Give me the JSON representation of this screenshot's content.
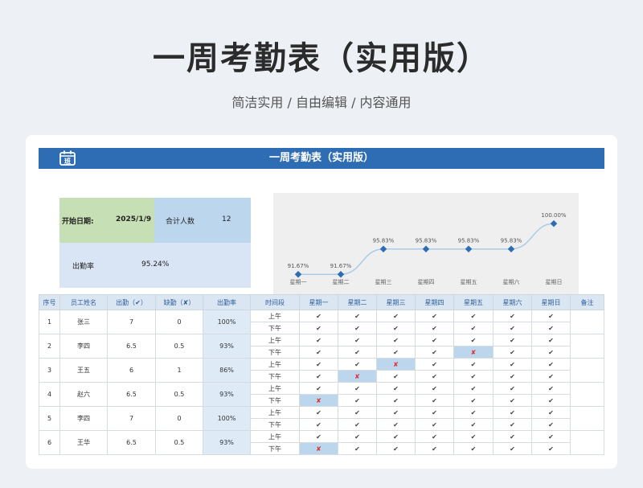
{
  "page": {
    "title": "一周考勤表（实用版）",
    "subtitle": "简洁实用 / 自由编辑 / 内容通用"
  },
  "sheet": {
    "banner_title": "一周考勤表（实用版）",
    "calendar_icon_text": "班",
    "summary": {
      "start_label": "开始日期:",
      "start_value": "2025/1/9",
      "count_label": "合计人数",
      "count_value": "12",
      "rate_label": "出勤率",
      "rate_value": "95.24%"
    }
  },
  "chart_data": {
    "type": "line",
    "categories": [
      "星期一",
      "星期二",
      "星期三",
      "星期四",
      "星期五",
      "星期六",
      "星期日"
    ],
    "values": [
      91.67,
      91.67,
      95.83,
      95.83,
      95.83,
      95.83,
      100.0
    ],
    "value_labels": [
      "91.67%",
      "91.67%",
      "95.83%",
      "95.83%",
      "95.83%",
      "95.83%",
      "100.00%"
    ],
    "ylim": [
      88,
      102
    ],
    "grid": false,
    "colors": {
      "line": "#a9cbe8",
      "marker": "#2e6db4"
    }
  },
  "table": {
    "headers": [
      "序号",
      "员工姓名",
      "出勤（✔）",
      "缺勤（✘）",
      "出勤率",
      "时间段",
      "星期一",
      "星期二",
      "星期三",
      "星期四",
      "星期五",
      "星期六",
      "星期日",
      "备注"
    ],
    "present_mark": "✔",
    "absent_mark": "✘",
    "rows": [
      {
        "no": "1",
        "name": "张三",
        "present": "7",
        "absent": "0",
        "rate": "100%",
        "am": "上午",
        "pm": "下午",
        "am_marks": [
          "✔",
          "✔",
          "✔",
          "✔",
          "✔",
          "✔",
          "✔"
        ],
        "pm_marks": [
          "✔",
          "✔",
          "✔",
          "✔",
          "✔",
          "✔",
          "✔"
        ]
      },
      {
        "no": "2",
        "name": "李四",
        "present": "6.5",
        "absent": "0.5",
        "rate": "93%",
        "am": "上午",
        "pm": "下午",
        "am_marks": [
          "✔",
          "✔",
          "✔",
          "✔",
          "✔",
          "✔",
          "✔"
        ],
        "pm_marks": [
          "✔",
          "✔",
          "✔",
          "✔",
          "✘",
          "✔",
          "✔"
        ]
      },
      {
        "no": "3",
        "name": "王五",
        "present": "6",
        "absent": "1",
        "rate": "86%",
        "am": "上午",
        "pm": "下午",
        "am_marks": [
          "✔",
          "✔",
          "✘",
          "✔",
          "✔",
          "✔",
          "✔"
        ],
        "pm_marks": [
          "✔",
          "✘",
          "✔",
          "✔",
          "✔",
          "✔",
          "✔"
        ]
      },
      {
        "no": "4",
        "name": "赵六",
        "present": "6.5",
        "absent": "0.5",
        "rate": "93%",
        "am": "上午",
        "pm": "下午",
        "am_marks": [
          "✔",
          "✔",
          "✔",
          "✔",
          "✔",
          "✔",
          "✔"
        ],
        "pm_marks": [
          "✘",
          "✔",
          "✔",
          "✔",
          "✔",
          "✔",
          "✔"
        ]
      },
      {
        "no": "5",
        "name": "李四",
        "present": "7",
        "absent": "0",
        "rate": "100%",
        "am": "上午",
        "pm": "下午",
        "am_marks": [
          "✔",
          "✔",
          "✔",
          "✔",
          "✔",
          "✔",
          "✔"
        ],
        "pm_marks": [
          "✔",
          "✔",
          "✔",
          "✔",
          "✔",
          "✔",
          "✔"
        ]
      },
      {
        "no": "6",
        "name": "王华",
        "present": "6.5",
        "absent": "0.5",
        "rate": "93%",
        "am": "上午",
        "pm": "下午",
        "am_marks": [
          "✔",
          "✔",
          "✔",
          "✔",
          "✔",
          "✔",
          "✔"
        ],
        "pm_marks": [
          "✘",
          "✔",
          "✔",
          "✔",
          "✔",
          "✔",
          "✔"
        ]
      }
    ]
  }
}
